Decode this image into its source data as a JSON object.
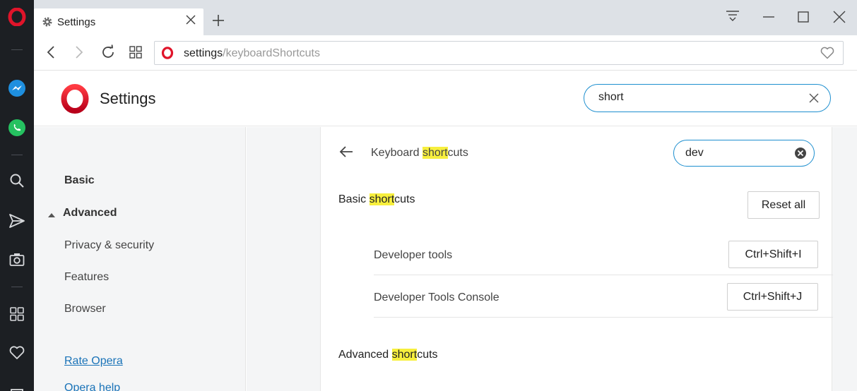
{
  "tab": {
    "title": "Settings"
  },
  "address": {
    "host": "settings",
    "path": "/keyboardShortcuts"
  },
  "header": {
    "title": "Settings",
    "search_value": "short"
  },
  "nav": {
    "basic": "Basic",
    "advanced": "Advanced",
    "items": [
      "Privacy & security",
      "Features",
      "Browser"
    ],
    "links": [
      "Rate Opera",
      "Opera help"
    ]
  },
  "main": {
    "breadcrumb": {
      "before": "Keyboard ",
      "highlight": "short",
      "after": "cuts"
    },
    "search_value": "dev",
    "basic_section": {
      "before": "Basic ",
      "highlight": "short",
      "after": "cuts"
    },
    "reset_label": "Reset all",
    "shortcuts": [
      {
        "name": "Developer tools",
        "keys": "Ctrl+Shift+I"
      },
      {
        "name": "Developer Tools Console",
        "keys": "Ctrl+Shift+J"
      }
    ],
    "advanced_section": {
      "before": "Advanced ",
      "highlight": "short",
      "after": "cuts"
    }
  },
  "colors": {
    "accent": "#1e8fcf",
    "highlight": "#f7ef3d",
    "opera_red": "#e0142a",
    "sidebar": "#1c1f23"
  },
  "icons": [
    "opera-logo-icon",
    "messenger-icon",
    "whatsapp-icon",
    "search-icon",
    "send-icon",
    "camera-icon",
    "speed-dial-icon",
    "heart-icon",
    "gear-icon",
    "close-icon",
    "plus-icon",
    "back-icon",
    "forward-icon",
    "reload-icon",
    "tabs-grid-icon",
    "bookmark-heart-icon",
    "arrow-left-icon",
    "clear-search-icon",
    "collapse-triangle-icon"
  ]
}
